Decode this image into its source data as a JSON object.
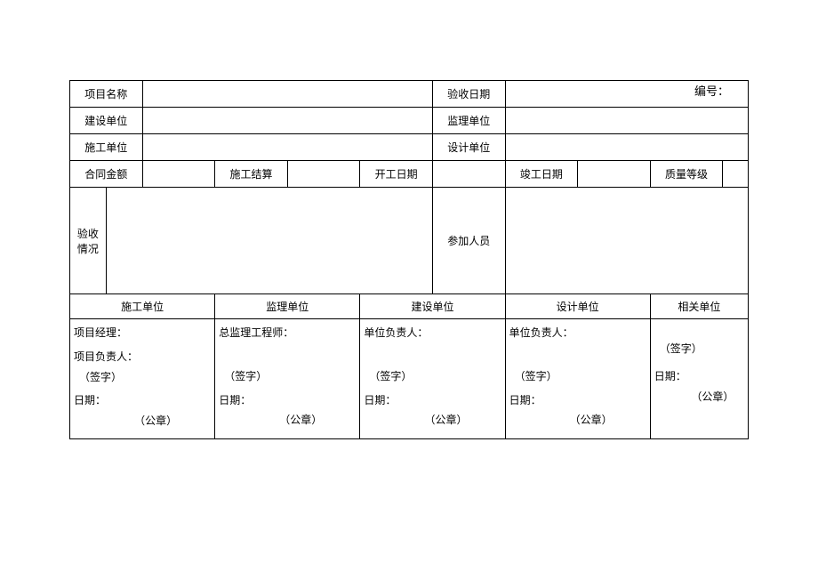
{
  "header": {
    "serial_label": "编号：",
    "serial_value": ""
  },
  "row1": {
    "project_name_label": "项目名称",
    "project_name_value": "",
    "accept_date_label": "验收日期",
    "accept_date_value": ""
  },
  "row2": {
    "build_unit_label": "建设单位",
    "build_unit_value": "",
    "supervise_unit_label": "监理单位",
    "supervise_unit_value": ""
  },
  "row3": {
    "construct_unit_label": "施工单位",
    "construct_unit_value": "",
    "design_unit_label": "设计单位",
    "design_unit_value": ""
  },
  "row4": {
    "contract_amount_label": "合同金额",
    "contract_amount_value": "",
    "settlement_label": "施工结算",
    "settlement_value": "",
    "start_date_label": "开工日期",
    "start_date_value": "",
    "finish_date_label": "竣工日期",
    "finish_date_value": "",
    "quality_label": "质量等级",
    "quality_value": ""
  },
  "row5": {
    "accept_status_label": "验收\n情况",
    "accept_status_value": "",
    "participants_label": "参加人员",
    "participants_value": ""
  },
  "sig_headers": {
    "construct": "施工单位",
    "supervise": "监理单位",
    "build": "建设单位",
    "design": "设计单位",
    "related": "相关单位"
  },
  "sig": {
    "construct": {
      "l1": "项目经理：",
      "l2": "项目负责人：",
      "sign": "（签字）",
      "date": "日期：",
      "seal": "（公章）"
    },
    "supervise": {
      "l1": "总监理工程师：",
      "sign": "（签字）",
      "date": "日期：",
      "seal": "（公章）"
    },
    "build": {
      "l1": "单位负责人：",
      "sign": "（签字）",
      "date": "日期：",
      "seal": "（公章）"
    },
    "design": {
      "l1": "单位负责人：",
      "sign": "（签字）",
      "date": "日期：",
      "seal": "（公章）"
    },
    "related": {
      "sign": "（签字）",
      "date": "日期：",
      "seal": "（公章）"
    }
  }
}
